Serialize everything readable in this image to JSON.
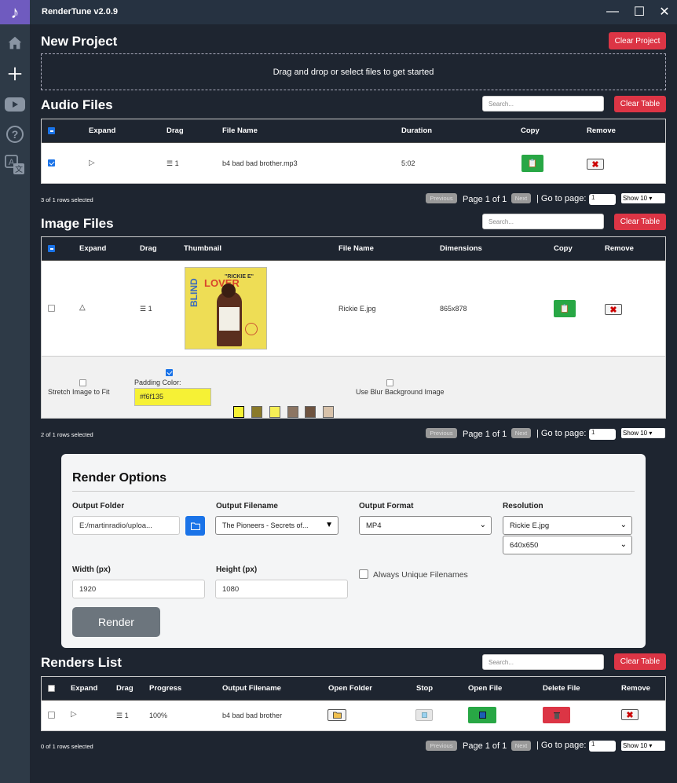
{
  "app": {
    "title": "RenderTune v2.0.9",
    "logo_glyph": "𝅘𝅥𝅮"
  },
  "window": {
    "minimize": "—",
    "maximize": "☐",
    "close": "✕"
  },
  "sidebar": {
    "items": [
      "home-icon",
      "plus-icon",
      "youtube-icon",
      "help-icon",
      "translate-icon"
    ]
  },
  "new_project": {
    "title": "New Project",
    "clear_label": "Clear Project",
    "dropzone_text": "Drag and drop or select files to get started"
  },
  "audio": {
    "title": "Audio Files",
    "search_placeholder": "Search...",
    "clear_label": "Clear Table",
    "columns": [
      "Expand",
      "Drag",
      "File Name",
      "Duration",
      "Copy",
      "Remove"
    ],
    "rows": [
      {
        "drag": "☰ 1",
        "file_name": "b4 bad bad brother.mp3",
        "duration": "5:02",
        "selected": true
      }
    ],
    "footer": "3 of 1 rows selected",
    "pagination": {
      "prev": "Previous",
      "page": "Page 1 of 1",
      "next": "Next",
      "goto": "| Go to page:",
      "goto_value": "1",
      "show": "Show 10"
    }
  },
  "image": {
    "title": "Image Files",
    "search_placeholder": "Search...",
    "clear_label": "Clear Table",
    "columns": [
      "Expand",
      "Drag",
      "Thumbnail",
      "File Name",
      "Dimensions",
      "Copy",
      "Remove"
    ],
    "rows": [
      {
        "drag": "☰ 1",
        "file_name": "Rickie E.jpg",
        "dimensions": "865x878",
        "thumb_text_1": "LOVER",
        "thumb_text_2": "\"RICKIE E\"",
        "thumb_text_3": "BLIND"
      }
    ],
    "options": {
      "stretch_label": "Stretch Image to Fit",
      "padding_label": "Padding Color:",
      "padding_value": "#f6f135",
      "blur_label": "Use Blur Background Image"
    },
    "swatches": [
      "#f6f135",
      "#8a7a2a",
      "#f7ef56",
      "#8c7563",
      "#6e5340",
      "#d8c2aa"
    ],
    "footer": "2 of 1 rows selected",
    "pagination": {
      "prev": "Previous",
      "page": "Page 1 of 1",
      "next": "Next",
      "goto": "| Go to page:",
      "goto_value": "1",
      "show": "Show 10"
    }
  },
  "render_options": {
    "title": "Render Options",
    "output_folder_label": "Output Folder",
    "output_folder_value": "E:/martinradio/uploa...",
    "output_filename_label": "Output Filename",
    "output_filename_value": "The Pioneers - Secrets of...",
    "output_format_label": "Output Format",
    "output_format_value": "MP4",
    "resolution_label": "Resolution",
    "resolution_image": "Rickie E.jpg",
    "resolution_value": "640x650",
    "width_label": "Width (px)",
    "width_value": "1920",
    "height_label": "Height (px)",
    "height_value": "1080",
    "unique_label": "Always Unique Filenames",
    "render_label": "Render"
  },
  "renders": {
    "title": "Renders List",
    "search_placeholder": "Search...",
    "clear_label": "Clear Table",
    "columns": [
      "Expand",
      "Drag",
      "Progress",
      "Output Filename",
      "Open Folder",
      "Stop",
      "Open File",
      "Delete File",
      "Remove"
    ],
    "rows": [
      {
        "drag": "☰ 1",
        "progress": "100%",
        "output_filename": "b4 bad bad brother"
      }
    ],
    "footer": "0 of 1 rows selected",
    "pagination": {
      "prev": "Previous",
      "page": "Page 1 of 1",
      "next": "Next",
      "goto": "| Go to page:",
      "goto_value": "1",
      "show": "Show 10"
    }
  },
  "colors": {
    "accent_red": "#dc3545",
    "copy_green": "#28a745",
    "folder_blue": "#1a73e8",
    "bg": "#1e2530"
  }
}
